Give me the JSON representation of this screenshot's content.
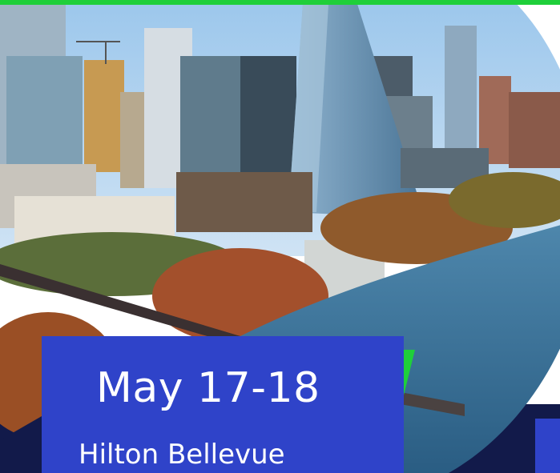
{
  "event": {
    "date": "May 17-18",
    "venue": "Hilton Bellevue"
  },
  "colors": {
    "accent_green": "#1fcf3a",
    "card_blue": "#2f43c9",
    "dark_navy": "#121a4a"
  },
  "icons": {
    "photo": "city-skyline-photo"
  }
}
